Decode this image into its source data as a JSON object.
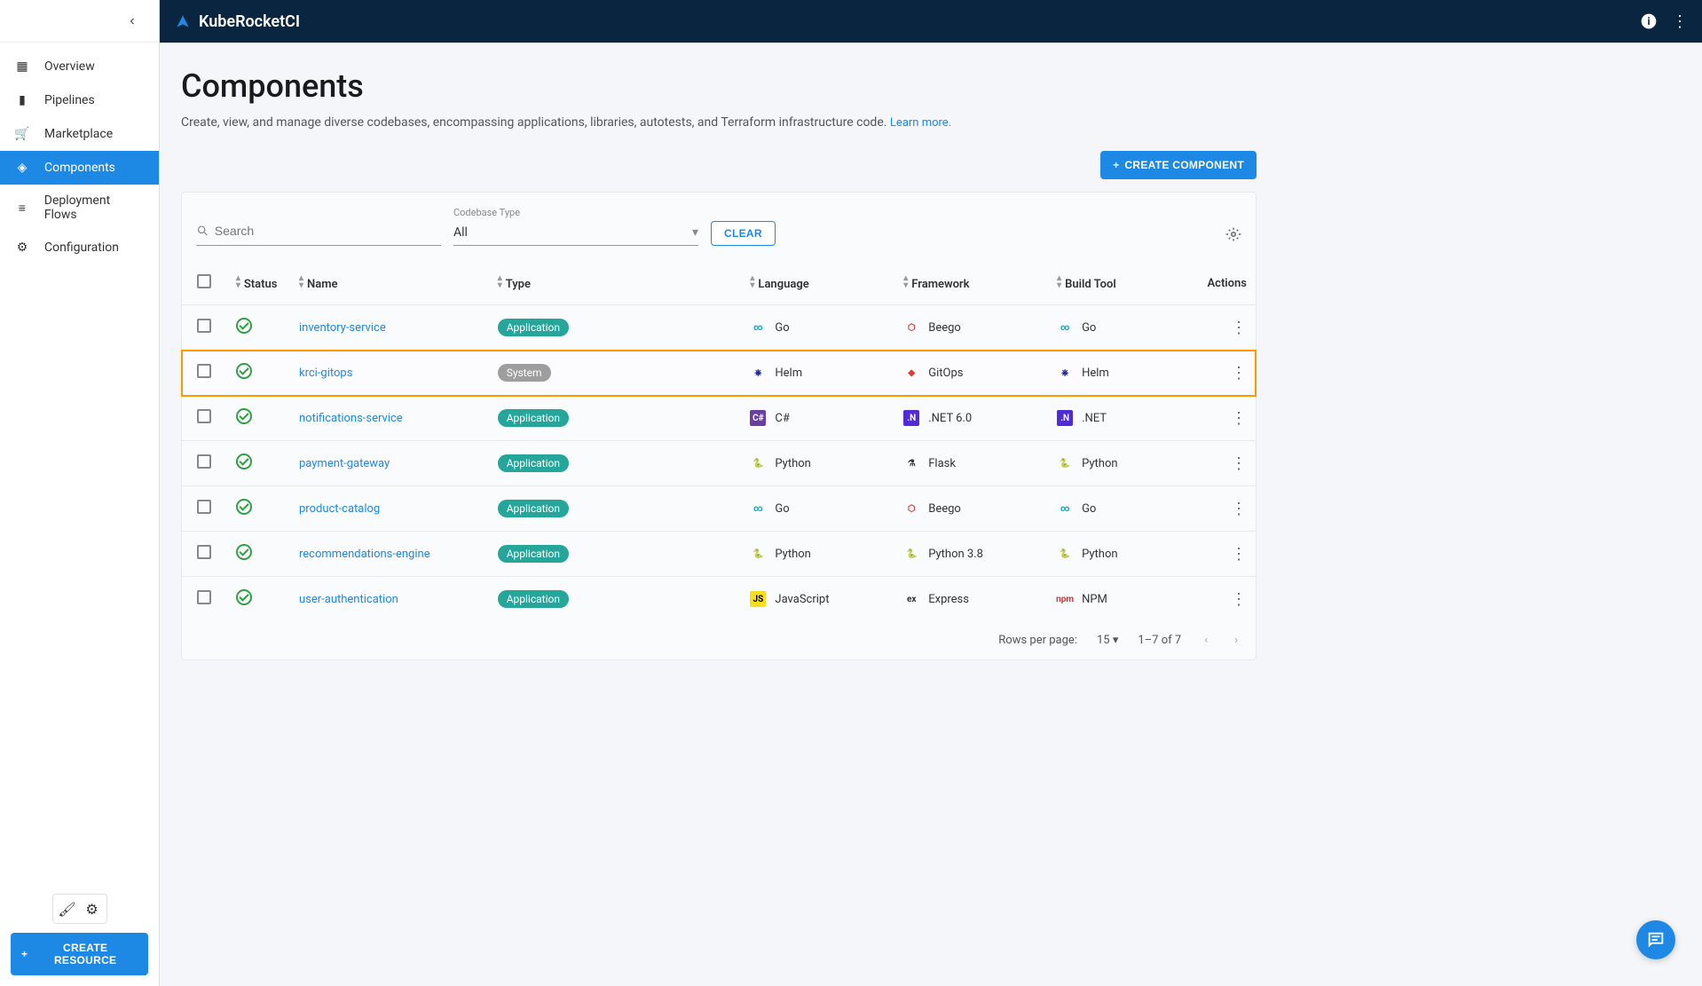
{
  "app": {
    "name": "KubeRocketCI"
  },
  "sidebar": {
    "items": [
      {
        "label": "Overview"
      },
      {
        "label": "Pipelines"
      },
      {
        "label": "Marketplace"
      },
      {
        "label": "Components"
      },
      {
        "label": "Deployment Flows"
      },
      {
        "label": "Configuration"
      }
    ],
    "create_resource_label": "CREATE RESOURCE"
  },
  "page": {
    "title": "Components",
    "subtitle": "Create, view, and manage diverse codebases, encompassing applications, libraries, autotests, and Terraform infrastructure code.",
    "learn_more": "Learn more.",
    "create_component_label": "CREATE COMPONENT"
  },
  "filters": {
    "search_placeholder": "Search",
    "codebase_label": "Codebase Type",
    "codebase_value": "All",
    "clear_label": "CLEAR"
  },
  "table": {
    "headers": {
      "status": "Status",
      "name": "Name",
      "type": "Type",
      "language": "Language",
      "framework": "Framework",
      "buildtool": "Build Tool",
      "actions": "Actions"
    },
    "rows": [
      {
        "name": "inventory-service",
        "type": "Application",
        "lang": "Go",
        "fw": "Beego",
        "bt": "Go",
        "highlight": false
      },
      {
        "name": "krci-gitops",
        "type": "System",
        "lang": "Helm",
        "fw": "GitOps",
        "bt": "Helm",
        "highlight": true
      },
      {
        "name": "notifications-service",
        "type": "Application",
        "lang": "C#",
        "fw": ".NET 6.0",
        "bt": ".NET",
        "highlight": false
      },
      {
        "name": "payment-gateway",
        "type": "Application",
        "lang": "Python",
        "fw": "Flask",
        "bt": "Python",
        "highlight": false
      },
      {
        "name": "product-catalog",
        "type": "Application",
        "lang": "Go",
        "fw": "Beego",
        "bt": "Go",
        "highlight": false
      },
      {
        "name": "recommendations-engine",
        "type": "Application",
        "lang": "Python",
        "fw": "Python 3.8",
        "bt": "Python",
        "highlight": false
      },
      {
        "name": "user-authentication",
        "type": "Application",
        "lang": "JavaScript",
        "fw": "Express",
        "bt": "NPM",
        "highlight": false
      }
    ]
  },
  "pagination": {
    "rows_per_page_label": "Rows per page:",
    "rows_per_page_value": "15",
    "range": "1–7 of 7"
  },
  "icons": {
    "Go": {
      "txt": "∞",
      "bg": "transparent",
      "fg": "#00ADD8"
    },
    "Beego": {
      "txt": "⬡",
      "bg": "transparent",
      "fg": "#d32f2f"
    },
    "Helm": {
      "txt": "⎈",
      "bg": "transparent",
      "fg": "#0f1689"
    },
    "GitOps": {
      "txt": "◆",
      "bg": "transparent",
      "fg": "#e53935"
    },
    "C#": {
      "txt": "C#",
      "bg": "#6b3fa0",
      "fg": "#fff"
    },
    ".NET 6.0": {
      "txt": ".N",
      "bg": "#512bd4",
      "fg": "#fff"
    },
    ".NET": {
      "txt": ".N",
      "bg": "#512bd4",
      "fg": "#fff"
    },
    "Python": {
      "txt": "🐍",
      "bg": "transparent",
      "fg": "#3776ab"
    },
    "Python 3.8": {
      "txt": "🐍",
      "bg": "transparent",
      "fg": "#3776ab"
    },
    "Flask": {
      "txt": "⚗",
      "bg": "transparent",
      "fg": "#333"
    },
    "JavaScript": {
      "txt": "JS",
      "bg": "#f7df1e",
      "fg": "#000"
    },
    "Express": {
      "txt": "ex",
      "bg": "transparent",
      "fg": "#333"
    },
    "NPM": {
      "txt": "npm",
      "bg": "transparent",
      "fg": "#cb3837"
    }
  }
}
